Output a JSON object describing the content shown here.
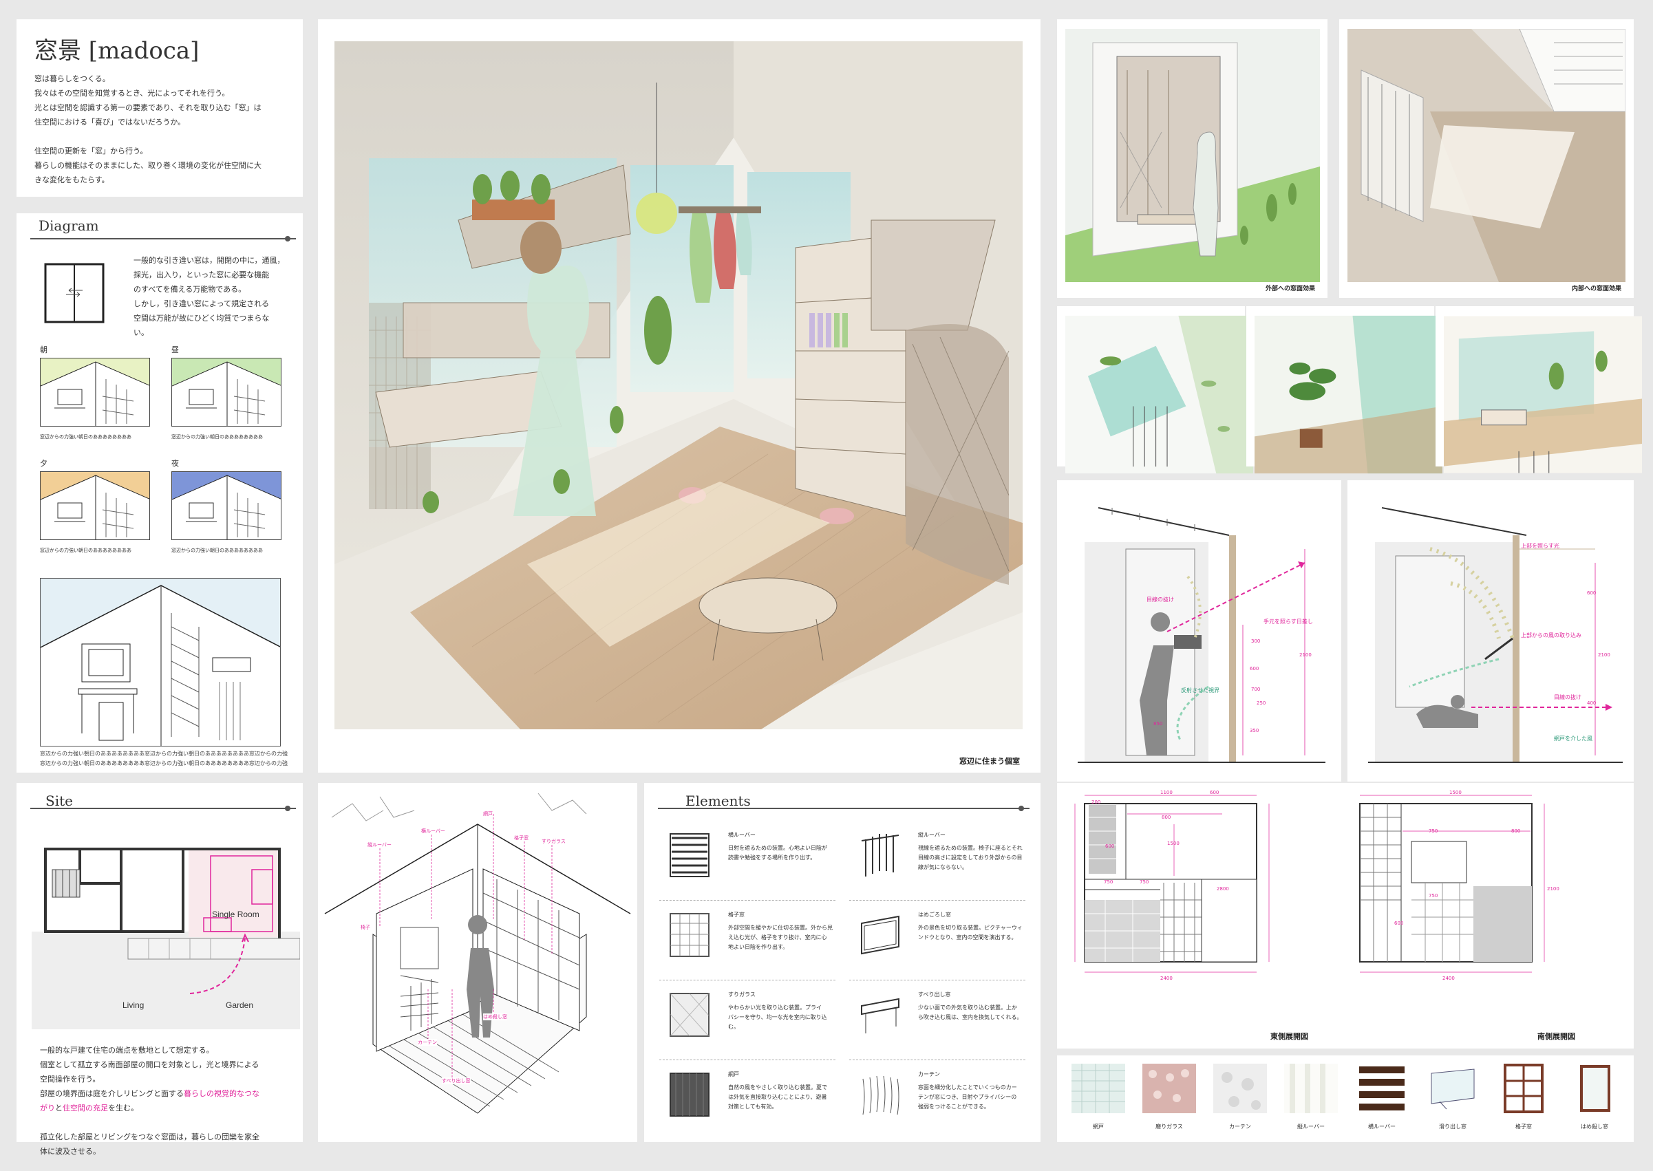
{
  "title_panel": {
    "title": "窓景 [madoca]",
    "paragraphs": [
      "窓は暮らしをつくる。",
      "我々はその空間を知覚するとき、光によってそれを行う。",
      "光とは空間を認識する第一の要素であり、それを取り込む「窓」は",
      "住空間における「喜び」ではないだろうか。",
      "",
      "住空間の更新を「窓」から行う。",
      "暮らしの機能はそのままにした、取り巻く環境の変化が住空間に大",
      "きな変化をもたらす。"
    ]
  },
  "diagram": {
    "heading": "Diagram",
    "text_lines": [
      "一般的な引き違い窓は，開閉の中に，通風，",
      "採光，出入り，といった窓に必要な機能",
      "のすべてを備える万能物である。",
      "しかし，引き違い窓によって規定される",
      "空間は万能が故にひどく均質でつまらな",
      "い。"
    ],
    "times": [
      {
        "label": "朝",
        "color": "#e8f2c4",
        "caption": "窓辺からの力強い朝日のああああああああ"
      },
      {
        "label": "昼",
        "color": "#c9e8b4",
        "caption": "窓辺からの力強い朝日のああああああああ"
      },
      {
        "label": "夕",
        "color": "#f2cf96",
        "caption": "窓辺からの力強い朝日のああああああああ"
      },
      {
        "label": "夜",
        "color": "#7e95d8",
        "caption": "窓辺からの力強い朝日のああああああああ"
      }
    ],
    "bottom_caption_1": "窓辺からの力強い朝日のああああああああ窓辺からの力強い朝日のああああああああ窓辺からの力強い朝日のああああああああ窓辺からの",
    "bottom_caption_2": "窓辺からの力強い朝日のああああああああ窓辺からの力強い朝日のああああああああ窓辺からの力強い朝日のああああああああ窓辺からの"
  },
  "main_render": {
    "caption": "窓辺に住まう個室"
  },
  "site": {
    "heading": "Site",
    "labels": {
      "room": "Single Room",
      "living": "Living",
      "garden": "Garden"
    },
    "p1": [
      "一般的な戸建て住宅の端点を敷地として想定する。",
      "個室として孤立する南面部屋の開口を対象とし，光と境界による",
      "空間操作を行う。"
    ],
    "p2_pre": "部屋の境界面は庭を介しリビングと面する",
    "p2_pink_1": "暮らしの視覚的なつな",
    "p2_pink_1b": "がり",
    "p2_mid": "と",
    "p2_pink_2": "住空間の充足",
    "p2_post": "を生む。",
    "p3": [
      "孤立化した部屋とリビングをつなぐ窓面は，暮らしの団欒を家全",
      "体に波及させる。"
    ]
  },
  "elements": {
    "heading": "Elements",
    "items": [
      {
        "name": "横ルーバー",
        "lines": [
          "日射を遮るための装置。心地よい日陰が",
          "読書や勉強をする場所を作り出す。"
        ]
      },
      {
        "name": "縦ルーバー",
        "lines": [
          "視線を遮るための装置。椅子に座るとそれ",
          "目線の高さに設定をしており外部からの目",
          "線が気にならない。"
        ]
      },
      {
        "name": "格子窓",
        "lines": [
          "外部空間を緩やかに仕切る装置。外から見",
          "え込む光が、格子をすり抜け、室内に心",
          "地よい日陰を作り出す。"
        ]
      },
      {
        "name": "はめごろし窓",
        "lines": [
          "外の景色を切り取る装置。ピクチャーウィ",
          "ンドウとなり、室内の空間を演出する。"
        ]
      },
      {
        "name": "すりガラス",
        "lines": [
          "やわらかい光を取り込む装置。プライ",
          "バシーを守り、均一な光を室内に取り込",
          "む。"
        ]
      },
      {
        "name": "すべり出し窓",
        "lines": [
          "少ない面での外気を取り込む装置。上か",
          "ら吹き込む風は、室内を換気してくれる。"
        ]
      },
      {
        "name": "網戸",
        "lines": [
          "自然の風をやさしく取り込む装置。夏で",
          "は外気を直接取り込むことにより、避暑",
          "対策としても有効。"
        ]
      },
      {
        "name": "カーテン",
        "lines": [
          "窓面を細分化したことでいくつものカー",
          "テンが窓につき、日射やプライバシーの",
          "強弱をつけることができる。"
        ]
      }
    ]
  },
  "top_right": {
    "caption_outer": "外部への窓面効果",
    "caption_inner": "内部への窓面効果"
  },
  "sections": {
    "left_labels": [
      "目線の抜け",
      "手元を照らす日差し",
      "反射させた視界"
    ],
    "right_labels": [
      "上部を照らす光",
      "上部からの風の取り込み",
      "目線の抜け",
      "網戸を介した風"
    ],
    "dims_left": [
      "2100",
      "700",
      "600",
      "300",
      "850",
      "350",
      "250"
    ],
    "dims_right": [
      "2100",
      "600",
      "400"
    ]
  },
  "elevations": {
    "east_caption": "東側展開図",
    "south_caption": "南側展開図",
    "east_dims": [
      "1100",
      "600",
      "800",
      "200",
      "750",
      "750",
      "2400",
      "2800",
      "1500",
      "600"
    ],
    "south_dims": [
      "1500",
      "750",
      "800",
      "750",
      "2400",
      "2100",
      "600"
    ]
  },
  "materials": [
    {
      "label": "網戸",
      "kind": "mesh"
    },
    {
      "label": "磨りガラス",
      "kind": "frosted-pink"
    },
    {
      "label": "カーテン",
      "kind": "lace"
    },
    {
      "label": "縦ルーバー",
      "kind": "vertical"
    },
    {
      "label": "横ルーバー",
      "kind": "horizontal"
    },
    {
      "label": "滑り出し窓",
      "kind": "awning"
    },
    {
      "label": "格子窓",
      "kind": "lattice"
    },
    {
      "label": "はめ殺し窓",
      "kind": "fixed"
    }
  ],
  "axon_labels": [
    "縦ルーバー",
    "横ルーバー",
    "網戸",
    "格子窓",
    "すりガラス",
    "カーテン",
    "すべり出し窓",
    "はめ殺し窓",
    "椅子"
  ]
}
